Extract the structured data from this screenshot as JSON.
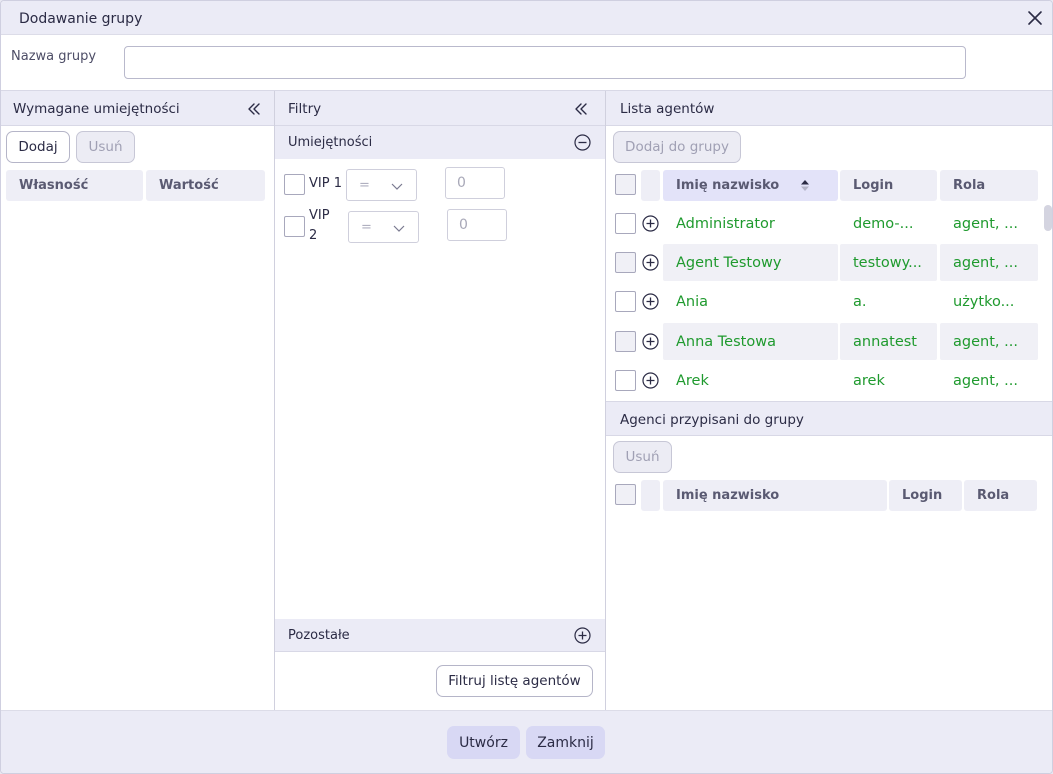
{
  "dialog": {
    "title": "Dodawanie grupy"
  },
  "group_name": {
    "label": "Nazwa grupy",
    "value": "",
    "placeholder": ""
  },
  "required_skills": {
    "title": "Wymagane umiejętności",
    "add_label": "Dodaj",
    "remove_label": "Usuń",
    "columns": [
      "Własność",
      "Wartość"
    ]
  },
  "filters": {
    "title": "Filtry",
    "skills_title": "Umiejętności",
    "skills": [
      {
        "label": "VIP 1",
        "operator": "=",
        "value": "0"
      },
      {
        "label": "VIP 2",
        "operator": "=",
        "value": "0"
      }
    ],
    "other_title": "Pozostałe",
    "filter_button": "Filtruj listę agentów"
  },
  "agents_list": {
    "title": "Lista agentów",
    "add_to_group": "Dodaj do grupy",
    "columns": [
      "Imię nazwisko",
      "Login",
      "Rola"
    ],
    "rows": [
      {
        "name": "Administrator",
        "login": "demo-...",
        "role": "agent, ..."
      },
      {
        "name": "Agent Testowy",
        "login": "testowy...",
        "role": "agent, ..."
      },
      {
        "name": "Ania",
        "login": "a.",
        "role": "użytko..."
      },
      {
        "name": "Anna Testowa",
        "login": "annatest",
        "role": "agent, ..."
      },
      {
        "name": "Arek",
        "login": "arek",
        "role": "agent, ..."
      }
    ]
  },
  "assigned_agents": {
    "title": "Agenci przypisani do grupy",
    "remove_label": "Usuń",
    "columns": [
      "Imię nazwisko",
      "Login",
      "Rola"
    ]
  },
  "footer": {
    "create_label": "Utwórz",
    "close_label": "Zamknij"
  },
  "colors": {
    "accent": "#d8d8f4",
    "header_bg": "#ebebf6",
    "agent_text": "#1f9a2e"
  }
}
